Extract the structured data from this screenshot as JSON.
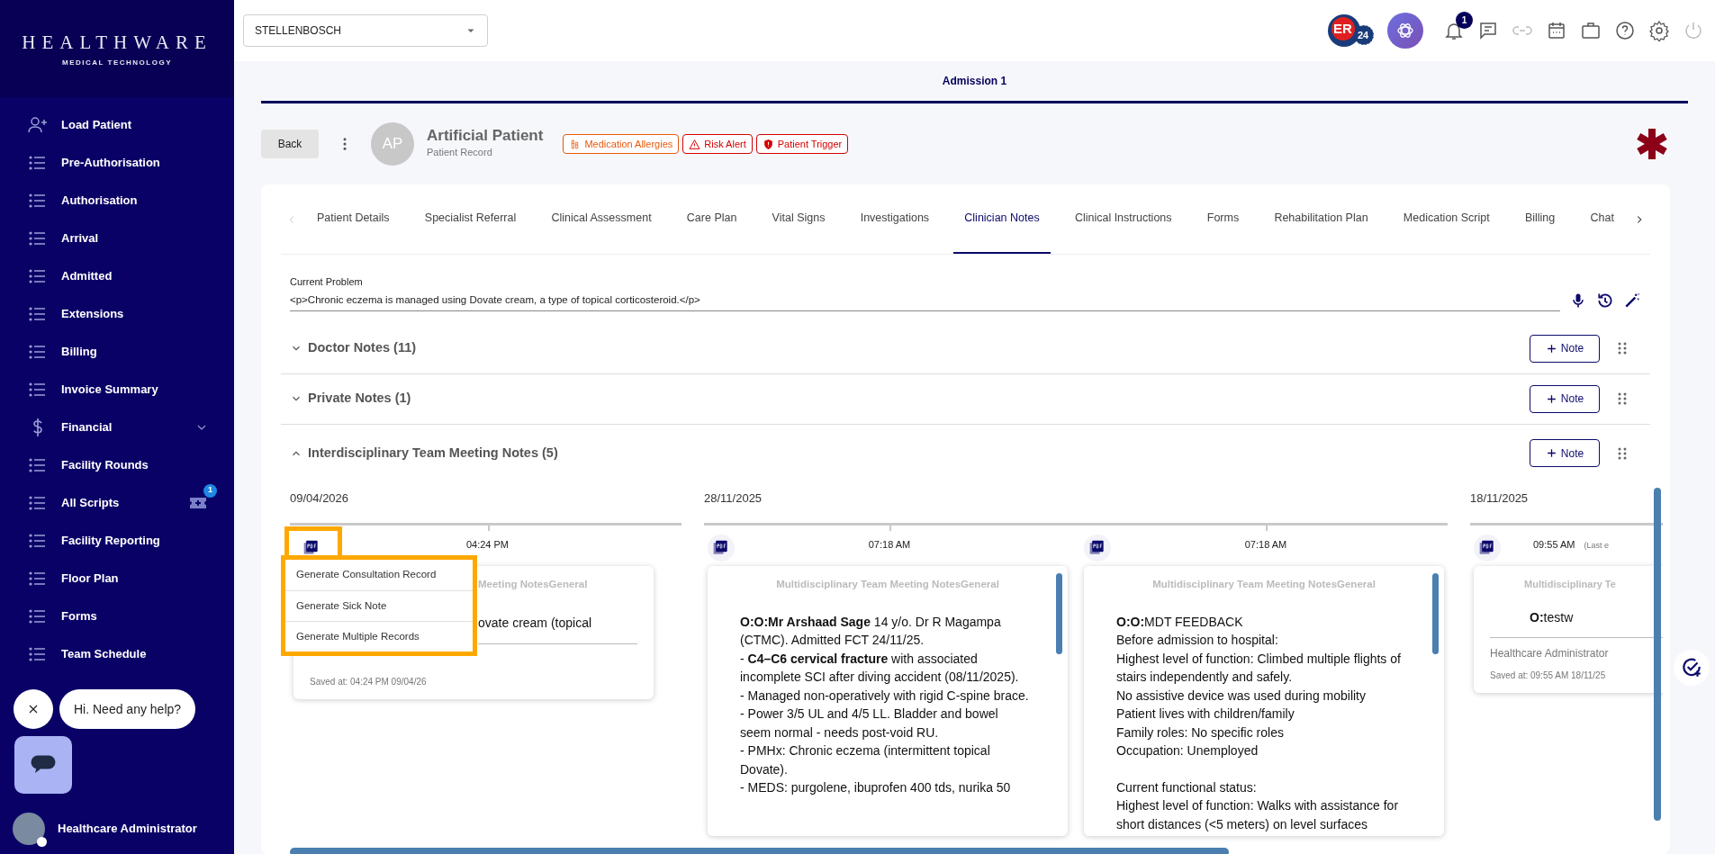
{
  "sidebar": {
    "logo": {
      "title": "HEALTHWARE",
      "subtitle": "MEDICAL TECHNOLOGY"
    },
    "items": [
      {
        "label": "Load Patient",
        "kind": "user-add"
      },
      {
        "label": "Pre-Authorisation",
        "kind": "list"
      },
      {
        "label": "Authorisation",
        "kind": "list"
      },
      {
        "label": "Arrival",
        "kind": "list"
      },
      {
        "label": "Admitted",
        "kind": "list"
      },
      {
        "label": "Extensions",
        "kind": "list"
      },
      {
        "label": "Billing",
        "kind": "list"
      },
      {
        "label": "Invoice Summary",
        "kind": "list"
      },
      {
        "label": "Financial",
        "kind": "group"
      },
      {
        "label": "Facility Rounds",
        "kind": "list"
      },
      {
        "label": "All Scripts",
        "kind": "list",
        "badge": "1"
      },
      {
        "label": "Facility Reporting",
        "kind": "list"
      },
      {
        "label": "Floor Plan",
        "kind": "list"
      },
      {
        "label": "Forms",
        "kind": "list"
      },
      {
        "label": "Team Schedule",
        "kind": "list"
      }
    ],
    "user": {
      "name": "Healthcare Administrator",
      "online": true
    }
  },
  "chat_widget": {
    "greeting": "Hi. Need any help?"
  },
  "topbar": {
    "location": "STELLENBOSCH",
    "er_logo": {
      "text": "ER",
      "number": "24"
    },
    "notifications": "1",
    "tools": [
      {
        "kind": "chat",
        "disabled": false
      },
      {
        "kind": "link",
        "disabled": true
      },
      {
        "kind": "calendar",
        "disabled": false
      },
      {
        "kind": "briefcase",
        "disabled": false
      },
      {
        "kind": "help",
        "disabled": false
      },
      {
        "kind": "settings",
        "disabled": false
      },
      {
        "kind": "power",
        "disabled": true
      }
    ]
  },
  "admission_tabs": [
    {
      "label": "Admission 1",
      "selected": true
    }
  ],
  "patient": {
    "back": "Back",
    "initials": "AP",
    "name": "Artificial Patient",
    "subtitle": "Patient Record",
    "alerts": [
      {
        "label": "Medication Allergies",
        "kind": "allergy",
        "color": "#e8590c"
      },
      {
        "label": "Risk Alert",
        "kind": "risk",
        "color": "#d40000"
      },
      {
        "label": "Patient Trigger",
        "kind": "trigger",
        "color": "#d40000"
      }
    ]
  },
  "tabs": [
    {
      "label": "Patient Details",
      "selected": false
    },
    {
      "label": "Specialist Referral",
      "selected": false
    },
    {
      "label": "Clinical Assessment",
      "selected": false
    },
    {
      "label": "Care Plan",
      "selected": false
    },
    {
      "label": "Vital Signs",
      "selected": false
    },
    {
      "label": "Investigations",
      "selected": false
    },
    {
      "label": "Clinician Notes",
      "selected": true
    },
    {
      "label": "Clinical Instructions",
      "selected": false
    },
    {
      "label": "Forms",
      "selected": false
    },
    {
      "label": "Rehabilitation Plan",
      "selected": false
    },
    {
      "label": "Medication Script",
      "selected": false
    },
    {
      "label": "Billing",
      "selected": false
    },
    {
      "label": "Chat",
      "selected": false
    }
  ],
  "current_problem": {
    "label": "Current Problem",
    "value": "<p>Chronic eczema is managed using Dovate cream, a type of topical corticosteroid.</p>"
  },
  "sections": [
    {
      "title": "Doctor Notes (11)",
      "expanded": false,
      "button": "Note"
    },
    {
      "title": "Private Notes (1)",
      "expanded": false,
      "button": "Note"
    },
    {
      "title": "Interdisciplinary Team Meeting Notes (5)",
      "expanded": true,
      "button": "Note"
    }
  ],
  "timeline": {
    "groups": [
      {
        "date": "09/04/2026",
        "cards": [
          {
            "time": "04:24 PM",
            "title": "Meeting NotesGeneral",
            "paragraphs": [
              [
                "ovate cream (topical"
              ]
            ],
            "saved_at": "Saved at: 04:24 PM 09/04/26",
            "menu": [
              "Generate Consultation Record",
              "Generate Sick Note",
              "Generate Multiple Records"
            ]
          }
        ]
      },
      {
        "date": "28/11/2025",
        "cards": [
          {
            "time": "07:18 AM",
            "title": "Multidisciplinary Team Meeting NotesGeneral",
            "paragraphs": [
              [
                "**O:O:Mr Arshaad Sage** 14 y/o. Dr R Magampa (CTMC). Admitted FCT 24/11/25.",
                "- **C4–C6 cervical fracture** with associated incomplete SCI after diving accident (08/11/2025).",
                "- Managed non-operatively with rigid C-spine brace.",
                "- Power 3/5 UL and 4/5 LL. Bladder and bowel seem normal - needs post-void RU.",
                "- PMHx: Chronic eczema (intermittent topical Dovate).",
                "- MEDS: purgolene, ibuprofen 400 tds, nurika 50"
              ]
            ]
          },
          {
            "time": "07:18 AM",
            "title": "Multidisciplinary Team Meeting NotesGeneral",
            "paragraphs": [
              [
                "**O:O:**MDT FEEDBACK",
                "Before admission to hospital:",
                "Highest level of function: Climbed multiple flights of stairs independently and safely.",
                "No assistive device was used during mobility",
                "Patient lives with children/family",
                "Family roles: No specific roles",
                "Occupation: Unemployed"
              ],
              [
                "Current functional status:",
                "Highest level of function: Walks with assistance for short distances (<5 meters) on level surfaces"
              ]
            ]
          }
        ]
      },
      {
        "date": "18/11/2025",
        "cards": [
          {
            "time": "09:55 AM",
            "extra": "(Last e",
            "title": "Multidisciplinary Te",
            "paragraphs": [
              [
                "**O:**testw"
              ]
            ],
            "author": "Healthcare Administrator",
            "saved_at": "Saved at: 09:55 AM 18/11/25"
          }
        ]
      }
    ]
  }
}
